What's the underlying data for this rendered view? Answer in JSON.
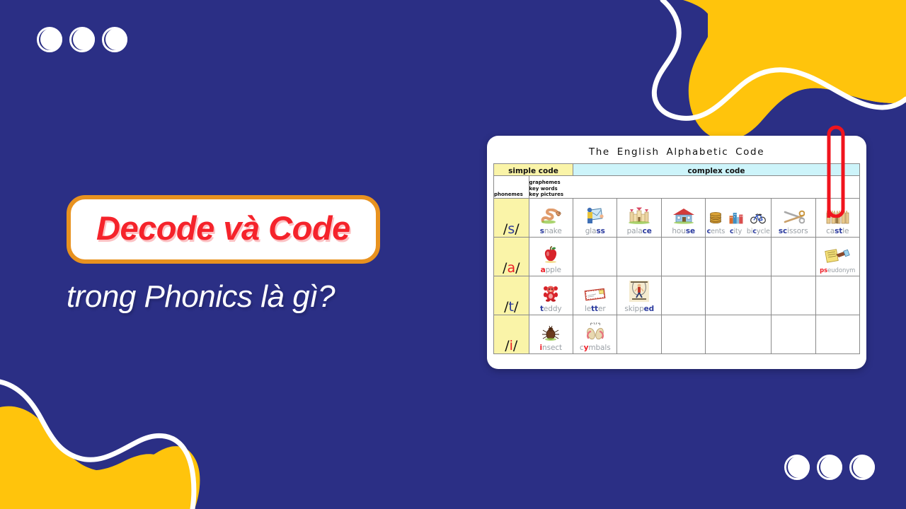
{
  "theme": {
    "navy": "#2B2F85",
    "yellow": "#FFC40C",
    "white": "#FFFFFF",
    "orange_border": "#E8921F",
    "red_text": "#F5232B",
    "paperclip_red": "#F0141E"
  },
  "headline": {
    "badge_title": "Decode và Code",
    "subtitle": "trong Phonics là gì?"
  },
  "decor": {
    "dots_top_left_count": 3,
    "dots_bottom_right_count": 3
  },
  "chart_card": {
    "title": "The  English  Alphabetic  Code",
    "bands": {
      "simple": "simple code",
      "complex": "complex code"
    },
    "sub_headers": {
      "phonemes": "phonemes",
      "graphemes_lines": "graphemes\nkey words\nkey pictures"
    },
    "sub_header_line_1": "graphemes",
    "sub_header_line_2": "key words",
    "sub_header_line_3": "key pictures",
    "rows": [
      {
        "phoneme": "s",
        "phoneme_display": "/s/",
        "phoneme_type": "consonant",
        "cells": [
          {
            "entries": [
              {
                "word": "snake",
                "grapheme": "s",
                "pic": "snake"
              }
            ]
          },
          {
            "entries": [
              {
                "word": "glass",
                "grapheme": "ss",
                "pic": "glass"
              }
            ]
          },
          {
            "entries": [
              {
                "word": "palace",
                "grapheme": "ce",
                "pic": "palace"
              }
            ]
          },
          {
            "entries": [
              {
                "word": "house",
                "grapheme": "se",
                "pic": "house"
              }
            ]
          },
          {
            "entries": [
              {
                "word": "cents",
                "grapheme": "c",
                "pic": "coins"
              },
              {
                "word": "city",
                "grapheme": "c",
                "pic": "city"
              },
              {
                "word": "bicycle",
                "grapheme": "c",
                "pic": "bicycle"
              }
            ]
          },
          {
            "entries": [
              {
                "word": "scissors",
                "grapheme": "sc",
                "pic": "scissors"
              }
            ]
          },
          {
            "entries": [
              {
                "word": "castle",
                "grapheme": "st",
                "pic": "castle"
              }
            ]
          }
        ]
      },
      {
        "phoneme": "a",
        "phoneme_display": "/a/",
        "phoneme_type": "vowel",
        "cells": [
          {
            "entries": [
              {
                "word": "apple",
                "grapheme": "a",
                "pic": "apple"
              }
            ]
          },
          {
            "entries": []
          },
          {
            "entries": []
          },
          {
            "entries": []
          },
          {
            "entries": []
          },
          {
            "entries": []
          },
          {
            "entries": [
              {
                "word": "pseudonym",
                "grapheme": "ps",
                "pic": "pseudonym"
              }
            ]
          }
        ]
      },
      {
        "phoneme": "t",
        "phoneme_display": "/t/",
        "phoneme_type": "consonant",
        "cells": [
          {
            "entries": [
              {
                "word": "teddy",
                "grapheme": "t",
                "pic": "teddy"
              }
            ]
          },
          {
            "entries": [
              {
                "word": "letter",
                "grapheme": "tt",
                "pic": "letter"
              }
            ]
          },
          {
            "entries": [
              {
                "word": "skipped",
                "grapheme": "ed",
                "pic": "skipped"
              }
            ]
          },
          {
            "entries": []
          },
          {
            "entries": []
          },
          {
            "entries": []
          },
          {
            "entries": []
          }
        ]
      },
      {
        "phoneme": "i",
        "phoneme_display": "/i/",
        "phoneme_type": "vowel",
        "cells": [
          {
            "entries": [
              {
                "word": "insect",
                "grapheme": "i",
                "pic": "insect"
              }
            ]
          },
          {
            "entries": [
              {
                "word": "cymbals",
                "grapheme": "y",
                "pic": "cymbals"
              }
            ]
          },
          {
            "entries": []
          },
          {
            "entries": []
          },
          {
            "entries": []
          },
          {
            "entries": []
          },
          {
            "entries": []
          }
        ]
      }
    ]
  }
}
